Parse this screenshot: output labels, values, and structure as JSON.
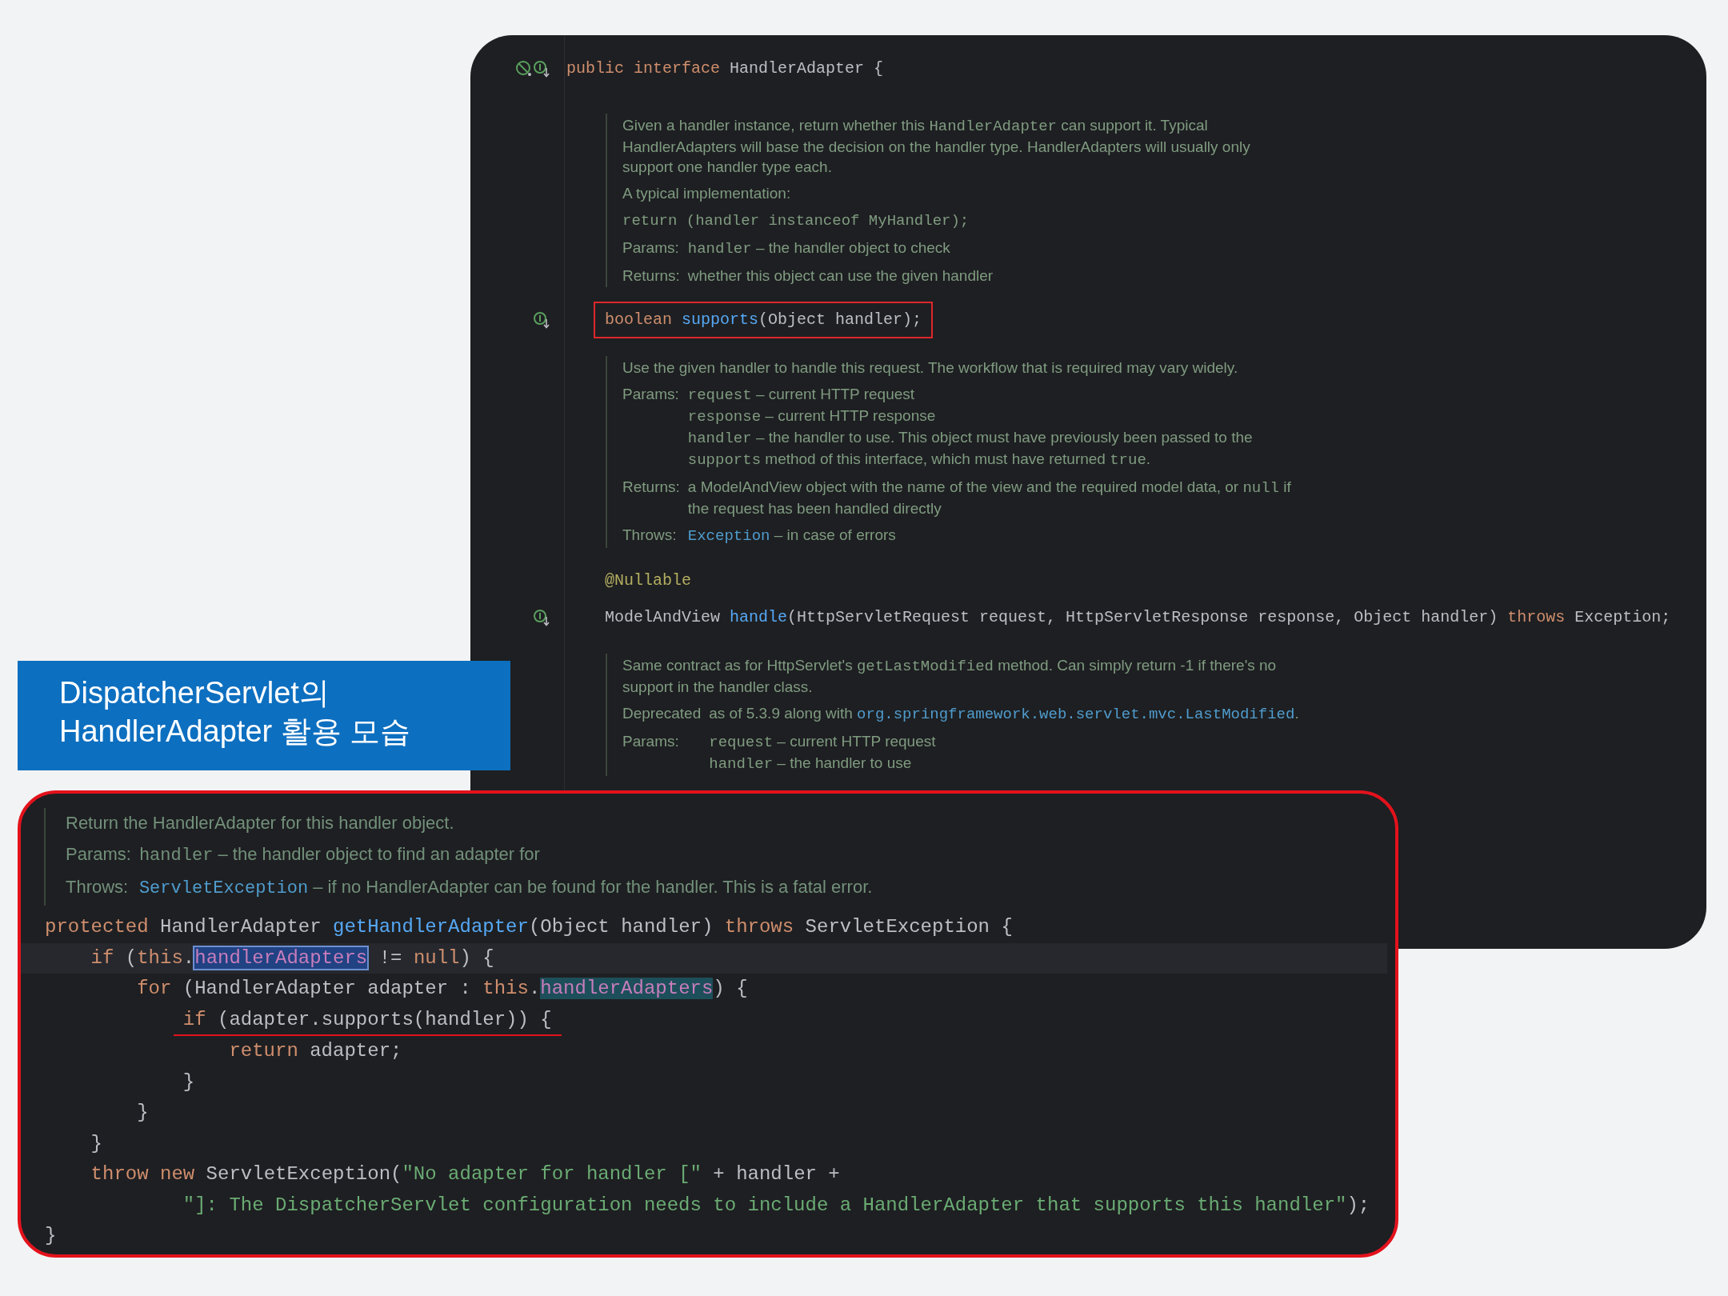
{
  "top_panel": {
    "declaration": {
      "prohibited_marker": true,
      "implemented_marker": true,
      "tokens": [
        {
          "text": "public interface",
          "kind": "keyword"
        },
        {
          "text": " HandlerAdapter {",
          "kind": "plain"
        }
      ]
    },
    "members": [
      {
        "kind": "doc",
        "sections": [
          {
            "lines": [
              [
                {
                  "text": "Given a handler instance, return whether this ",
                  "kind": "text"
                },
                {
                  "text": "HandlerAdapter",
                  "kind": "code"
                },
                {
                  "text": " can support it. Typical",
                  "kind": "text"
                }
              ],
              [
                {
                  "text": "HandlerAdapters will base the decision on the handler type. HandlerAdapters will usually only",
                  "kind": "text"
                }
              ],
              [
                {
                  "text": "support one handler type each.",
                  "kind": "text"
                }
              ]
            ]
          },
          {
            "lines": [
              [
                {
                  "text": "A typical implementation:",
                  "kind": "text"
                }
              ]
            ]
          },
          {
            "lines": [
              [
                {
                  "text": "return (handler instanceof MyHandler);",
                  "kind": "code"
                }
              ]
            ]
          },
          {
            "label": "Params:",
            "lines": [
              [
                {
                  "text": "handler",
                  "kind": "code"
                },
                {
                  "text": " – the handler object to check",
                  "kind": "text"
                }
              ]
            ]
          },
          {
            "label": "Returns:",
            "lines": [
              [
                {
                  "text": "whether this object can use the given handler",
                  "kind": "text"
                }
              ]
            ]
          }
        ]
      },
      {
        "kind": "code",
        "implemented_marker": true,
        "boxed": true,
        "tokens": [
          {
            "text": "boolean ",
            "kind": "keyword"
          },
          {
            "text": "supports",
            "kind": "method"
          },
          {
            "text": "(Object handler);",
            "kind": "plain"
          }
        ]
      },
      {
        "kind": "doc",
        "sections": [
          {
            "lines": [
              [
                {
                  "text": "Use the given handler to handle this request. The workflow that is required may vary widely.",
                  "kind": "text"
                }
              ]
            ]
          },
          {
            "label": "Params:",
            "lines": [
              [
                {
                  "text": "request",
                  "kind": "code"
                },
                {
                  "text": " – current HTTP request",
                  "kind": "text"
                }
              ],
              [
                {
                  "text": "response",
                  "kind": "code"
                },
                {
                  "text": " – current HTTP response",
                  "kind": "text"
                }
              ],
              [
                {
                  "text": "handler",
                  "kind": "code"
                },
                {
                  "text": " – the handler to use. This object must have previously been passed to the",
                  "kind": "text"
                }
              ],
              [
                {
                  "text": "supports",
                  "kind": "code"
                },
                {
                  "text": " method of this interface, which must have returned ",
                  "kind": "text"
                },
                {
                  "text": "true",
                  "kind": "code"
                },
                {
                  "text": ".",
                  "kind": "text"
                }
              ]
            ]
          },
          {
            "label": "Returns:",
            "lines": [
              [
                {
                  "text": "a ModelAndView object with the name of the view and the required model data, or ",
                  "kind": "text"
                },
                {
                  "text": "null",
                  "kind": "code"
                },
                {
                  "text": " if",
                  "kind": "text"
                }
              ],
              [
                {
                  "text": "the request has been handled directly",
                  "kind": "text"
                }
              ]
            ]
          },
          {
            "label": "Throws:",
            "lines": [
              [
                {
                  "text": "Exception",
                  "kind": "link"
                },
                {
                  "text": " – in case of errors",
                  "kind": "text"
                }
              ]
            ]
          }
        ]
      },
      {
        "kind": "code",
        "implemented_marker": false,
        "boxed": false,
        "tokens": [
          {
            "text": "@Nullable",
            "kind": "annotation"
          }
        ]
      },
      {
        "kind": "code",
        "implemented_marker": true,
        "boxed": false,
        "tokens": [
          {
            "text": "ModelAndView ",
            "kind": "plain"
          },
          {
            "text": "handle",
            "kind": "method"
          },
          {
            "text": "(HttpServletRequest request, HttpServletResponse response, Object handler) ",
            "kind": "plain"
          },
          {
            "text": "throws",
            "kind": "keyword"
          },
          {
            "text": " Exception;",
            "kind": "plain"
          }
        ]
      },
      {
        "kind": "doc",
        "sections": [
          {
            "lines": [
              [
                {
                  "text": "Same contract as for HttpServlet's ",
                  "kind": "text"
                },
                {
                  "text": "getLastModified",
                  "kind": "code"
                },
                {
                  "text": " method. Can simply return -1 if there's no",
                  "kind": "text"
                }
              ],
              [
                {
                  "text": "support in the handler class.",
                  "kind": "text"
                }
              ]
            ]
          },
          {
            "label": "Deprecated",
            "lines": [
              [
                {
                  "text": "as of 5.3.9 along with ",
                  "kind": "text"
                },
                {
                  "text": "org.springframework.web.servlet.mvc.LastModified",
                  "kind": "link"
                },
                {
                  "text": ".",
                  "kind": "text"
                }
              ]
            ]
          },
          {
            "label": "Params:",
            "lines": [
              [
                {
                  "text": "request",
                  "kind": "code"
                },
                {
                  "text": " – current HTTP request",
                  "kind": "text"
                }
              ],
              [
                {
                  "text": "handler",
                  "kind": "code"
                },
                {
                  "text": " – the handler to use",
                  "kind": "text"
                }
              ]
            ]
          }
        ]
      }
    ]
  },
  "caption": {
    "lines": [
      "DispatcherServlet의",
      "HandlerAdapter 활용 모습"
    ]
  },
  "bottom_panel": {
    "doc": {
      "sections": [
        {
          "lines": [
            [
              {
                "text": "Return the HandlerAdapter for this handler object.",
                "kind": "text"
              }
            ]
          ]
        },
        {
          "label": "Params:",
          "lines": [
            [
              {
                "text": "handler",
                "kind": "code"
              },
              {
                "text": " – the handler object to find an adapter for",
                "kind": "text"
              }
            ]
          ]
        },
        {
          "label": "Throws:",
          "lines": [
            [
              {
                "text": "ServletException",
                "kind": "link"
              },
              {
                "text": " – if no HandlerAdapter can be found for the handler. This is a fatal error.",
                "kind": "text"
              }
            ]
          ]
        }
      ]
    },
    "lines": [
      {
        "current": false,
        "tokens": [
          {
            "text": "protected",
            "kind": "keyword"
          },
          {
            "text": " HandlerAdapter ",
            "kind": "plain"
          },
          {
            "text": "getHandlerAdapter",
            "kind": "method"
          },
          {
            "text": "(Object handler) ",
            "kind": "plain"
          },
          {
            "text": "throws",
            "kind": "keyword"
          },
          {
            "text": " ServletException {",
            "kind": "plain"
          }
        ],
        "children": [
          {
            "current": true,
            "tokens": [
              {
                "text": "if",
                "kind": "keyword"
              },
              {
                "text": " (",
                "kind": "plain"
              },
              {
                "text": "this",
                "kind": "keyword"
              },
              {
                "text": ".",
                "kind": "plain"
              },
              {
                "text": "handlerAdapters",
                "kind": "field",
                "selected": true
              },
              {
                "text": " != ",
                "kind": "plain"
              },
              {
                "text": "null",
                "kind": "keyword"
              },
              {
                "text": ") {",
                "kind": "plain"
              }
            ],
            "children": [
              {
                "current": false,
                "tokens": [
                  {
                    "text": "for",
                    "kind": "keyword"
                  },
                  {
                    "text": " (HandlerAdapter adapter : ",
                    "kind": "plain"
                  },
                  {
                    "text": "this",
                    "kind": "keyword"
                  },
                  {
                    "text": ".",
                    "kind": "plain"
                  },
                  {
                    "text": "handlerAdapters",
                    "kind": "field",
                    "occurrence_highlight": true
                  },
                  {
                    "text": ") {",
                    "kind": "plain"
                  }
                ],
                "children": [
                  {
                    "current": false,
                    "underlined": true,
                    "tokens": [
                      {
                        "text": "if",
                        "kind": "keyword"
                      },
                      {
                        "text": " (adapter.supports(handler)) {",
                        "kind": "plain"
                      }
                    ],
                    "children": [
                      {
                        "current": false,
                        "tokens": [
                          {
                            "text": "return",
                            "kind": "keyword"
                          },
                          {
                            "text": " adapter;",
                            "kind": "plain"
                          }
                        ]
                      }
                    ]
                  },
                  {
                    "current": false,
                    "tokens": [
                      {
                        "text": "}",
                        "kind": "plain"
                      }
                    ]
                  }
                ]
              },
              {
                "current": false,
                "tokens": [
                  {
                    "text": "}",
                    "kind": "plain"
                  }
                ]
              }
            ]
          },
          {
            "current": false,
            "tokens": [
              {
                "text": "}",
                "kind": "plain"
              }
            ]
          },
          {
            "current": false,
            "tokens": [
              {
                "text": "throw new",
                "kind": "keyword"
              },
              {
                "text": " ServletException(",
                "kind": "plain"
              },
              {
                "text": "\"No adapter for handler [\"",
                "kind": "string"
              },
              {
                "text": " + handler +",
                "kind": "plain"
              }
            ],
            "children": [
              {
                "current": false,
                "continued": true,
                "tokens": [
                  {
                    "text": "\"]: The DispatcherServlet configuration needs to include a HandlerAdapter that supports this handler\"",
                    "kind": "string"
                  },
                  {
                    "text": ");",
                    "kind": "plain"
                  }
                ]
              }
            ]
          }
        ]
      },
      {
        "current": false,
        "tokens": [
          {
            "text": "}",
            "kind": "plain"
          }
        ]
      }
    ]
  }
}
